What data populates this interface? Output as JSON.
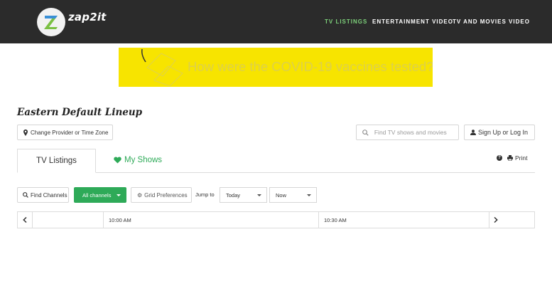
{
  "header": {
    "logo_text": "zap2it",
    "nav": [
      {
        "label": "TV LISTINGS",
        "active": true
      },
      {
        "label": "ENTERTAINMENT VIDEO",
        "active": false
      },
      {
        "label": "TV AND MOVIES VIDEO",
        "active": false
      }
    ],
    "colors": {
      "background": "#2b2b2b",
      "active_nav": "#7ed27b"
    }
  },
  "ad": {
    "text": "How were the COVID-19 vaccines tested?",
    "background": "#f7e400"
  },
  "lineup": {
    "title": "Eastern Default Lineup",
    "change_provider_label": "Change Provider or Time Zone"
  },
  "search": {
    "placeholder": "Find TV shows and movies"
  },
  "account": {
    "sign_in_label": "Sign Up or Log In"
  },
  "tabs": {
    "tv_listings": "TV Listings",
    "my_shows": "My Shows",
    "print_label": "Print"
  },
  "toolbar": {
    "find_channels": "Find Channels",
    "all_channels": "All channels",
    "grid_preferences": "Grid Preferences",
    "jump_to": "Jump to",
    "day_select": "Today",
    "time_select": "Now",
    "accent": "#2eaa58"
  },
  "grid": {
    "times": [
      "10:00 AM",
      "10:30 AM"
    ]
  }
}
